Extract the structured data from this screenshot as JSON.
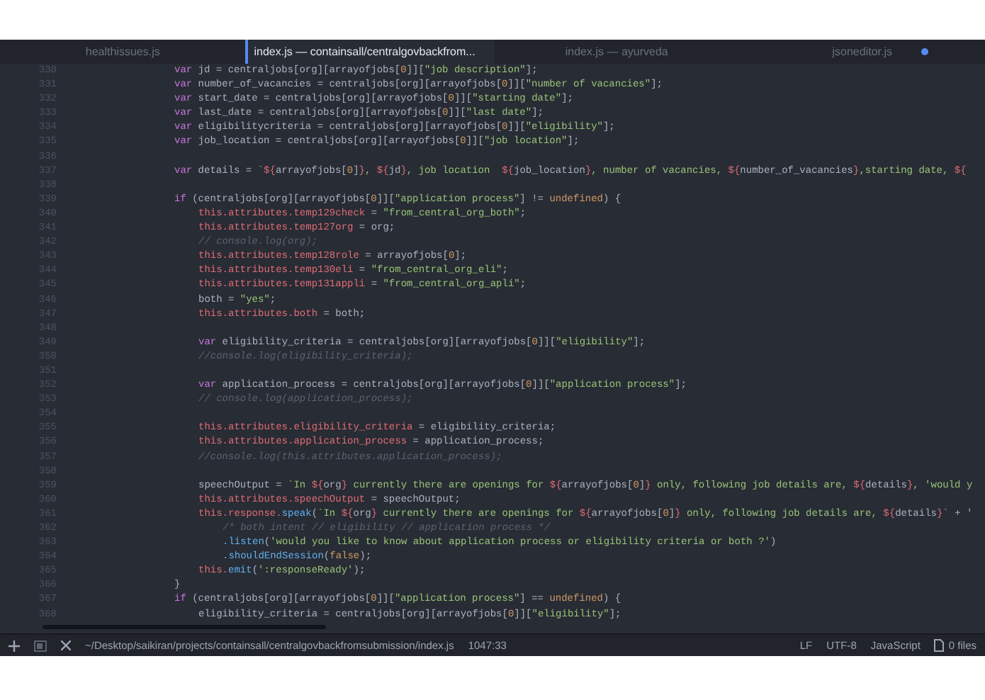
{
  "tabs": [
    {
      "label": "healthissues.js",
      "selected": false,
      "modified": false
    },
    {
      "label": "index.js — containsall/centralgovbackfrom...",
      "selected": true,
      "modified": false
    },
    {
      "label": "index.js — ayurveda",
      "selected": false,
      "modified": false
    },
    {
      "label": "jsoneditor.js",
      "selected": false,
      "modified": true
    }
  ],
  "editor": {
    "lines": [
      {
        "number": "330",
        "kind": "outer",
        "tokens": [
          {
            "kind": "keyword",
            "text": "var"
          },
          {
            "kind": "plain",
            "text": " jd = centraljobs[org][arrayofjobs["
          },
          {
            "kind": "number",
            "text": "0"
          },
          {
            "kind": "plain",
            "text": "]]["
          },
          {
            "kind": "string",
            "text": "\"job description\""
          },
          {
            "kind": "plain",
            "text": "];"
          }
        ]
      },
      {
        "number": "331",
        "kind": "outer",
        "tokens": [
          {
            "kind": "keyword",
            "text": "var"
          },
          {
            "kind": "plain",
            "text": " number_of_vacancies = centraljobs[org][arrayofjobs["
          },
          {
            "kind": "number",
            "text": "0"
          },
          {
            "kind": "plain",
            "text": "]]["
          },
          {
            "kind": "string",
            "text": "\"number of vacancies\""
          },
          {
            "kind": "plain",
            "text": "];"
          }
        ]
      },
      {
        "number": "332",
        "kind": "outer",
        "tokens": [
          {
            "kind": "keyword",
            "text": "var"
          },
          {
            "kind": "plain",
            "text": " start_date = centraljobs[org][arrayofjobs["
          },
          {
            "kind": "number",
            "text": "0"
          },
          {
            "kind": "plain",
            "text": "]]["
          },
          {
            "kind": "string",
            "text": "\"starting date\""
          },
          {
            "kind": "plain",
            "text": "];"
          }
        ]
      },
      {
        "number": "333",
        "kind": "outer",
        "tokens": [
          {
            "kind": "keyword",
            "text": "var"
          },
          {
            "kind": "plain",
            "text": " last_date = centraljobs[org][arrayofjobs["
          },
          {
            "kind": "number",
            "text": "0"
          },
          {
            "kind": "plain",
            "text": "]]["
          },
          {
            "kind": "string",
            "text": "\"last date\""
          },
          {
            "kind": "plain",
            "text": "];"
          }
        ]
      },
      {
        "number": "334",
        "kind": "outer",
        "tokens": [
          {
            "kind": "keyword",
            "text": "var"
          },
          {
            "kind": "plain",
            "text": " eligibilitycriteria = centraljobs[org][arrayofjobs["
          },
          {
            "kind": "number",
            "text": "0"
          },
          {
            "kind": "plain",
            "text": "]]["
          },
          {
            "kind": "string",
            "text": "\"eligibility\""
          },
          {
            "kind": "plain",
            "text": "];"
          }
        ]
      },
      {
        "number": "335",
        "kind": "outer",
        "tokens": [
          {
            "kind": "keyword",
            "text": "var"
          },
          {
            "kind": "plain",
            "text": " job_location = centraljobs[org][arrayofjobs["
          },
          {
            "kind": "number",
            "text": "0"
          },
          {
            "kind": "plain",
            "text": "]]["
          },
          {
            "kind": "string",
            "text": "\"job location\""
          },
          {
            "kind": "plain",
            "text": "];"
          }
        ]
      },
      {
        "number": "336",
        "kind": "blank"
      },
      {
        "number": "337",
        "kind": "outer",
        "tokens": [
          {
            "kind": "keyword",
            "text": "var"
          },
          {
            "kind": "plain",
            "text": " details = "
          },
          {
            "kind": "string",
            "text": "`"
          },
          {
            "kind": "interp",
            "text": "${"
          },
          {
            "kind": "plain",
            "text": "arrayofjobs["
          },
          {
            "kind": "number",
            "text": "0"
          },
          {
            "kind": "plain",
            "text": "]"
          },
          {
            "kind": "interp",
            "text": "}"
          },
          {
            "kind": "string",
            "text": ", "
          },
          {
            "kind": "interp",
            "text": "${"
          },
          {
            "kind": "plain",
            "text": "jd"
          },
          {
            "kind": "interp",
            "text": "}"
          },
          {
            "kind": "string",
            "text": ", job location  "
          },
          {
            "kind": "interp",
            "text": "${"
          },
          {
            "kind": "plain",
            "text": "job_location"
          },
          {
            "kind": "interp",
            "text": "}"
          },
          {
            "kind": "string",
            "text": ", number of vacancies, "
          },
          {
            "kind": "interp",
            "text": "${"
          },
          {
            "kind": "plain",
            "text": "number_of_vacancies"
          },
          {
            "kind": "interp",
            "text": "}"
          },
          {
            "kind": "string",
            "text": ",starting date, "
          },
          {
            "kind": "interp",
            "text": "${"
          }
        ]
      },
      {
        "number": "338",
        "kind": "blank"
      },
      {
        "number": "339",
        "kind": "outer",
        "tokens": [
          {
            "kind": "keyword",
            "text": "if"
          },
          {
            "kind": "plain",
            "text": " (centraljobs[org][arrayofjobs["
          },
          {
            "kind": "number",
            "text": "0"
          },
          {
            "kind": "plain",
            "text": "]]["
          },
          {
            "kind": "string",
            "text": "\"application process\""
          },
          {
            "kind": "plain",
            "text": "] != "
          },
          {
            "kind": "constant",
            "text": "undefined"
          },
          {
            "kind": "plain",
            "text": ") {"
          }
        ]
      },
      {
        "number": "340",
        "kind": "inner",
        "tokens": [
          {
            "kind": "member",
            "text": "this.attributes.temp129check"
          },
          {
            "kind": "plain",
            "text": " = "
          },
          {
            "kind": "string",
            "text": "\"from_central_org_both\""
          },
          {
            "kind": "plain",
            "text": ";"
          }
        ]
      },
      {
        "number": "341",
        "kind": "inner",
        "tokens": [
          {
            "kind": "member",
            "text": "this.attributes.temp127org"
          },
          {
            "kind": "plain",
            "text": " = org;"
          }
        ]
      },
      {
        "number": "342",
        "kind": "inner",
        "tokens": [
          {
            "kind": "comment",
            "text": "// console.log(org);"
          }
        ]
      },
      {
        "number": "343",
        "kind": "inner",
        "tokens": [
          {
            "kind": "member",
            "text": "this.attributes.temp128role"
          },
          {
            "kind": "plain",
            "text": " = arrayofjobs["
          },
          {
            "kind": "number",
            "text": "0"
          },
          {
            "kind": "plain",
            "text": "];"
          }
        ]
      },
      {
        "number": "344",
        "kind": "inner",
        "tokens": [
          {
            "kind": "member",
            "text": "this.attributes.temp130eli"
          },
          {
            "kind": "plain",
            "text": " = "
          },
          {
            "kind": "string",
            "text": "\"from_central_org_eli\""
          },
          {
            "kind": "plain",
            "text": ";"
          }
        ]
      },
      {
        "number": "345",
        "kind": "inner",
        "tokens": [
          {
            "kind": "member",
            "text": "this.attributes.temp131appli"
          },
          {
            "kind": "plain",
            "text": " = "
          },
          {
            "kind": "string",
            "text": "\"from_central_org_apli\""
          },
          {
            "kind": "plain",
            "text": ";"
          }
        ]
      },
      {
        "number": "346",
        "kind": "inner",
        "tokens": [
          {
            "kind": "plain",
            "text": "both = "
          },
          {
            "kind": "string",
            "text": "\"yes\""
          },
          {
            "kind": "plain",
            "text": ";"
          }
        ]
      },
      {
        "number": "347",
        "kind": "inner",
        "tokens": [
          {
            "kind": "member",
            "text": "this.attributes.both"
          },
          {
            "kind": "plain",
            "text": " = both;"
          }
        ]
      },
      {
        "number": "348",
        "kind": "blank"
      },
      {
        "number": "349",
        "kind": "inner",
        "tokens": [
          {
            "kind": "keyword",
            "text": "var"
          },
          {
            "kind": "plain",
            "text": " eligibility_criteria = centraljobs[org][arrayofjobs["
          },
          {
            "kind": "number",
            "text": "0"
          },
          {
            "kind": "plain",
            "text": "]]["
          },
          {
            "kind": "string",
            "text": "\"eligibility\""
          },
          {
            "kind": "plain",
            "text": "];"
          }
        ]
      },
      {
        "number": "350",
        "kind": "inner",
        "tokens": [
          {
            "kind": "comment",
            "text": "//console.log(eligibility_criteria);"
          }
        ]
      },
      {
        "number": "351",
        "kind": "blank"
      },
      {
        "number": "352",
        "kind": "inner",
        "tokens": [
          {
            "kind": "keyword",
            "text": "var"
          },
          {
            "kind": "plain",
            "text": " application_process = centraljobs[org][arrayofjobs["
          },
          {
            "kind": "number",
            "text": "0"
          },
          {
            "kind": "plain",
            "text": "]]["
          },
          {
            "kind": "string",
            "text": "\"application process\""
          },
          {
            "kind": "plain",
            "text": "];"
          }
        ]
      },
      {
        "number": "353",
        "kind": "inner",
        "tokens": [
          {
            "kind": "comment",
            "text": "// console.log(application_process);"
          }
        ]
      },
      {
        "number": "354",
        "kind": "blank"
      },
      {
        "number": "355",
        "kind": "inner",
        "tokens": [
          {
            "kind": "member",
            "text": "this.attributes.eligibility_criteria"
          },
          {
            "kind": "plain",
            "text": " = eligibility_criteria;"
          }
        ]
      },
      {
        "number": "356",
        "kind": "inner",
        "tokens": [
          {
            "kind": "member",
            "text": "this.attributes.application_process"
          },
          {
            "kind": "plain",
            "text": " = application_process;"
          }
        ]
      },
      {
        "number": "357",
        "kind": "inner",
        "tokens": [
          {
            "kind": "comment",
            "text": "//console.log(this.attributes.application_process);"
          }
        ]
      },
      {
        "number": "358",
        "kind": "blank"
      },
      {
        "number": "359",
        "kind": "inner",
        "tokens": [
          {
            "kind": "plain",
            "text": "speechOutput = "
          },
          {
            "kind": "string",
            "text": "`In "
          },
          {
            "kind": "interp",
            "text": "${"
          },
          {
            "kind": "plain",
            "text": "org"
          },
          {
            "kind": "interp",
            "text": "}"
          },
          {
            "kind": "string",
            "text": " currently there are openings for "
          },
          {
            "kind": "interp",
            "text": "${"
          },
          {
            "kind": "plain",
            "text": "arrayofjobs["
          },
          {
            "kind": "number",
            "text": "0"
          },
          {
            "kind": "plain",
            "text": "]"
          },
          {
            "kind": "interp",
            "text": "}"
          },
          {
            "kind": "string",
            "text": " only, following job details are, "
          },
          {
            "kind": "interp",
            "text": "${"
          },
          {
            "kind": "plain",
            "text": "details"
          },
          {
            "kind": "interp",
            "text": "}"
          },
          {
            "kind": "string",
            "text": ", 'would y"
          }
        ]
      },
      {
        "number": "360",
        "kind": "inner",
        "tokens": [
          {
            "kind": "member",
            "text": "this.attributes.speechOutput"
          },
          {
            "kind": "plain",
            "text": " = speechOutput;"
          }
        ]
      },
      {
        "number": "361",
        "kind": "inner",
        "tokens": [
          {
            "kind": "member",
            "text": "this.response."
          },
          {
            "kind": "function",
            "text": "speak"
          },
          {
            "kind": "plain",
            "text": "("
          },
          {
            "kind": "string",
            "text": "`In "
          },
          {
            "kind": "interp",
            "text": "${"
          },
          {
            "kind": "plain",
            "text": "org"
          },
          {
            "kind": "interp",
            "text": "}"
          },
          {
            "kind": "string",
            "text": " currently there are openings for "
          },
          {
            "kind": "interp",
            "text": "${"
          },
          {
            "kind": "plain",
            "text": "arrayofjobs["
          },
          {
            "kind": "number",
            "text": "0"
          },
          {
            "kind": "plain",
            "text": "]"
          },
          {
            "kind": "interp",
            "text": "}"
          },
          {
            "kind": "string",
            "text": " only, following job details are, "
          },
          {
            "kind": "interp",
            "text": "${"
          },
          {
            "kind": "plain",
            "text": "details"
          },
          {
            "kind": "interp",
            "text": "}"
          },
          {
            "kind": "string",
            "text": "`"
          },
          {
            "kind": "plain",
            "text": " + "
          },
          {
            "kind": "string",
            "text": "'"
          }
        ]
      },
      {
        "number": "362",
        "kind": "continuation",
        "tokens": [
          {
            "kind": "comment",
            "text": "/* both intent // eligibility // application process */"
          }
        ]
      },
      {
        "number": "363",
        "kind": "continuation",
        "tokens": [
          {
            "kind": "function",
            "text": ".listen"
          },
          {
            "kind": "plain",
            "text": "("
          },
          {
            "kind": "string",
            "text": "'would you like to know about application process or eligibility criteria or both ?'"
          },
          {
            "kind": "plain",
            "text": ")"
          }
        ]
      },
      {
        "number": "364",
        "kind": "continuation",
        "tokens": [
          {
            "kind": "function",
            "text": ".shouldEndSession"
          },
          {
            "kind": "plain",
            "text": "("
          },
          {
            "kind": "constant",
            "text": "false"
          },
          {
            "kind": "plain",
            "text": ");"
          }
        ]
      },
      {
        "number": "365",
        "kind": "inner",
        "tokens": [
          {
            "kind": "member",
            "text": "this."
          },
          {
            "kind": "function",
            "text": "emit"
          },
          {
            "kind": "plain",
            "text": "("
          },
          {
            "kind": "string",
            "text": "':responseReady'"
          },
          {
            "kind": "plain",
            "text": ");"
          }
        ]
      },
      {
        "number": "366",
        "kind": "outer",
        "tokens": [
          {
            "kind": "plain",
            "text": "}"
          }
        ]
      },
      {
        "number": "367",
        "kind": "outer",
        "tokens": [
          {
            "kind": "keyword",
            "text": "if"
          },
          {
            "kind": "plain",
            "text": " (centraljobs[org][arrayofjobs["
          },
          {
            "kind": "number",
            "text": "0"
          },
          {
            "kind": "plain",
            "text": "]]["
          },
          {
            "kind": "string",
            "text": "\"application process\""
          },
          {
            "kind": "plain",
            "text": "] == "
          },
          {
            "kind": "constant",
            "text": "undefined"
          },
          {
            "kind": "plain",
            "text": ") {"
          }
        ]
      },
      {
        "number": "368",
        "kind": "inner",
        "tokens": [
          {
            "kind": "plain",
            "text": "eligibility_criteria = centraljobs[org][arrayofjobs["
          },
          {
            "kind": "number",
            "text": "0"
          },
          {
            "kind": "plain",
            "text": "]]["
          },
          {
            "kind": "string",
            "text": "\"eligibility\""
          },
          {
            "kind": "plain",
            "text": "];"
          }
        ]
      }
    ]
  },
  "status_bar": {
    "path": "~/Desktop/saikiran/projects/containsall/centralgovbackfromsubmission/index.js",
    "cursor": "1047:33",
    "line_ending": "LF",
    "encoding": "UTF-8",
    "grammar": "JavaScript",
    "files": "0 files"
  }
}
